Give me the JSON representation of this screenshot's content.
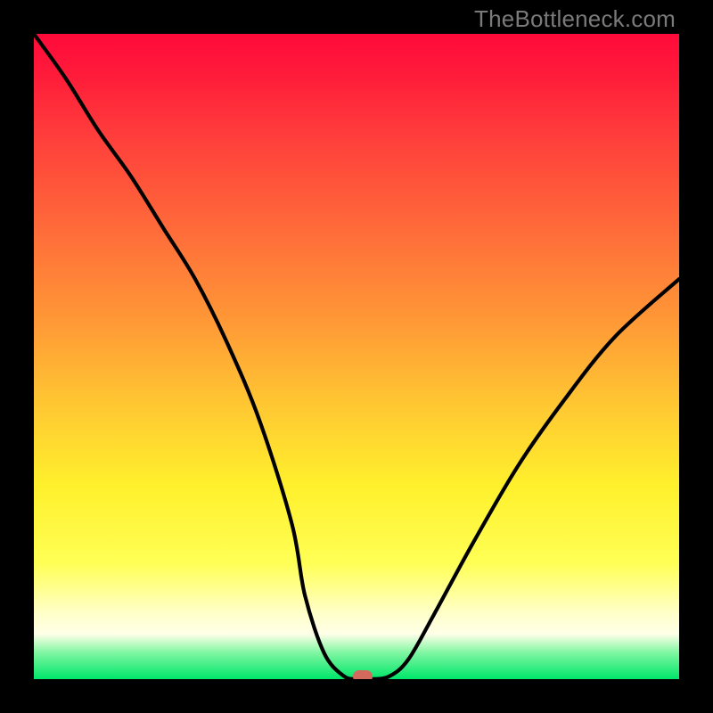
{
  "watermark": "TheBottleneck.com",
  "colors": {
    "frame": "#000000",
    "curve": "#000000",
    "marker": "#d36a5e",
    "gradient_top": "#ff0a3a",
    "gradient_bottom": "#00e66a"
  },
  "chart_data": {
    "type": "line",
    "title": "",
    "xlabel": "",
    "ylabel": "",
    "xlim": [
      0,
      100
    ],
    "ylim": [
      0,
      100
    ],
    "grid": false,
    "series": [
      {
        "name": "bottleneck-curve",
        "x": [
          0,
          5,
          10,
          15,
          20,
          25,
          30,
          35,
          40,
          42,
          45,
          48,
          50,
          52,
          55,
          58,
          62,
          68,
          75,
          82,
          90,
          100
        ],
        "y": [
          100,
          93,
          85,
          78,
          70,
          62,
          52,
          40,
          24,
          13,
          4,
          0.5,
          0,
          0,
          0.4,
          3,
          10,
          21,
          33,
          43,
          53,
          62
        ]
      }
    ],
    "marker": {
      "x": 51,
      "y": 0
    },
    "annotations": []
  }
}
